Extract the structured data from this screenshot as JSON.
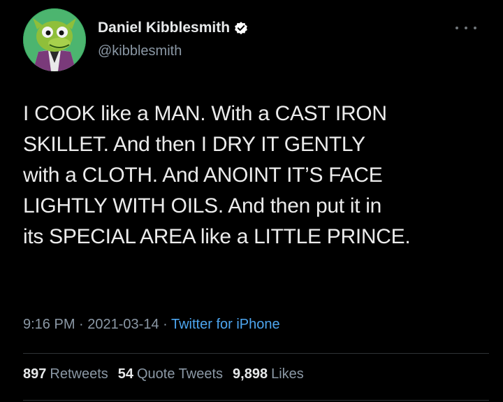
{
  "author": {
    "name": "Daniel Kibblesmith",
    "handle": "@kibblesmith",
    "verified": true
  },
  "tweet": {
    "lines": [
      "I COOK like a MAN. With a CAST IRON",
      "SKILLET. And then I DRY IT GENTLY",
      "with a CLOTH. And ANOINT IT’S FACE",
      "LIGHTLY WITH OILS. And then put it in",
      "its SPECIAL AREA like a LITTLE PRINCE."
    ]
  },
  "meta": {
    "time": "9:16 PM",
    "separator": " · ",
    "date": "2021-03-14",
    "source": "Twitter for iPhone"
  },
  "stats": {
    "retweets": {
      "count": "897",
      "label": "Retweets"
    },
    "quotes": {
      "count": "54",
      "label": "Quote Tweets"
    },
    "likes": {
      "count": "9,898",
      "label": "Likes"
    }
  },
  "colors": {
    "background": "#000000",
    "text": "#e7e9ea",
    "secondary": "#8b98a5",
    "link": "#4da6f0",
    "verified_badge": "#ffffff",
    "avatar_bg": "#2f9e58"
  },
  "icons": {
    "verified": "verified-badge-icon",
    "more": "more-dots-icon"
  }
}
